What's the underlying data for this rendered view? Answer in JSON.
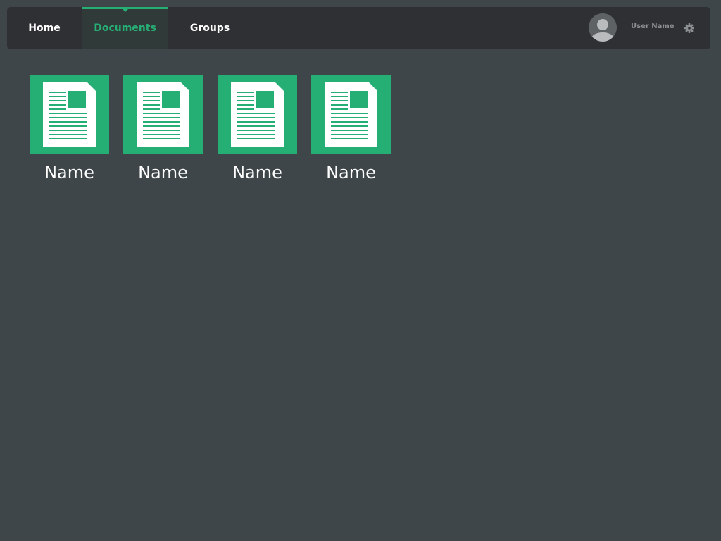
{
  "nav": {
    "tabs": [
      {
        "label": "Home",
        "active": false
      },
      {
        "label": "Documents",
        "active": true
      },
      {
        "label": "Groups",
        "active": false
      }
    ]
  },
  "user": {
    "name": "User Name",
    "avatar_icon": "user-avatar-icon",
    "settings_icon": "gear-icon"
  },
  "documents": [
    {
      "name": "Name",
      "icon": "document-icon"
    },
    {
      "name": "Name",
      "icon": "document-icon"
    },
    {
      "name": "Name",
      "icon": "document-icon"
    },
    {
      "name": "Name",
      "icon": "document-icon"
    }
  ],
  "colors": {
    "accent": "#26af75",
    "background": "#3f4649",
    "navbar": "#2e3033"
  }
}
